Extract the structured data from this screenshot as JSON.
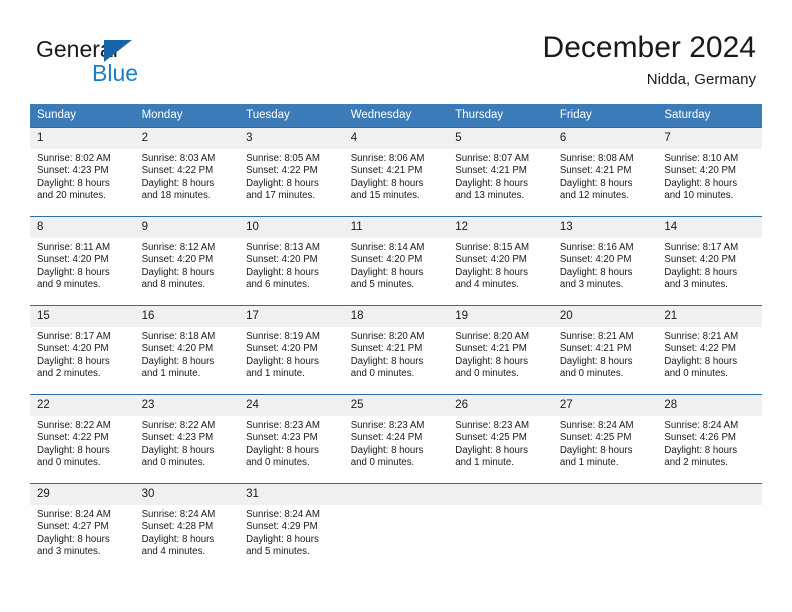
{
  "logo": {
    "word1": "General",
    "word2": "Blue",
    "triangle_color": "#1565a8",
    "blue_color": "#1b7fc4"
  },
  "header": {
    "title": "December 2024",
    "subtitle": "Nidda, Germany"
  },
  "theme": {
    "header_bar": "#3b7cb8",
    "row_divider": "#2d6ca8",
    "daynum_band": "#f0f0f0",
    "text": "#1a1a1a"
  },
  "weekday_headers": [
    "Sunday",
    "Monday",
    "Tuesday",
    "Wednesday",
    "Thursday",
    "Friday",
    "Saturday"
  ],
  "weeks": [
    [
      {
        "day": "1",
        "sunrise": "Sunrise: 8:02 AM",
        "sunset": "Sunset: 4:23 PM",
        "daylight1": "Daylight: 8 hours",
        "daylight2": "and 20 minutes."
      },
      {
        "day": "2",
        "sunrise": "Sunrise: 8:03 AM",
        "sunset": "Sunset: 4:22 PM",
        "daylight1": "Daylight: 8 hours",
        "daylight2": "and 18 minutes."
      },
      {
        "day": "3",
        "sunrise": "Sunrise: 8:05 AM",
        "sunset": "Sunset: 4:22 PM",
        "daylight1": "Daylight: 8 hours",
        "daylight2": "and 17 minutes."
      },
      {
        "day": "4",
        "sunrise": "Sunrise: 8:06 AM",
        "sunset": "Sunset: 4:21 PM",
        "daylight1": "Daylight: 8 hours",
        "daylight2": "and 15 minutes."
      },
      {
        "day": "5",
        "sunrise": "Sunrise: 8:07 AM",
        "sunset": "Sunset: 4:21 PM",
        "daylight1": "Daylight: 8 hours",
        "daylight2": "and 13 minutes."
      },
      {
        "day": "6",
        "sunrise": "Sunrise: 8:08 AM",
        "sunset": "Sunset: 4:21 PM",
        "daylight1": "Daylight: 8 hours",
        "daylight2": "and 12 minutes."
      },
      {
        "day": "7",
        "sunrise": "Sunrise: 8:10 AM",
        "sunset": "Sunset: 4:20 PM",
        "daylight1": "Daylight: 8 hours",
        "daylight2": "and 10 minutes."
      }
    ],
    [
      {
        "day": "8",
        "sunrise": "Sunrise: 8:11 AM",
        "sunset": "Sunset: 4:20 PM",
        "daylight1": "Daylight: 8 hours",
        "daylight2": "and 9 minutes."
      },
      {
        "day": "9",
        "sunrise": "Sunrise: 8:12 AM",
        "sunset": "Sunset: 4:20 PM",
        "daylight1": "Daylight: 8 hours",
        "daylight2": "and 8 minutes."
      },
      {
        "day": "10",
        "sunrise": "Sunrise: 8:13 AM",
        "sunset": "Sunset: 4:20 PM",
        "daylight1": "Daylight: 8 hours",
        "daylight2": "and 6 minutes."
      },
      {
        "day": "11",
        "sunrise": "Sunrise: 8:14 AM",
        "sunset": "Sunset: 4:20 PM",
        "daylight1": "Daylight: 8 hours",
        "daylight2": "and 5 minutes."
      },
      {
        "day": "12",
        "sunrise": "Sunrise: 8:15 AM",
        "sunset": "Sunset: 4:20 PM",
        "daylight1": "Daylight: 8 hours",
        "daylight2": "and 4 minutes."
      },
      {
        "day": "13",
        "sunrise": "Sunrise: 8:16 AM",
        "sunset": "Sunset: 4:20 PM",
        "daylight1": "Daylight: 8 hours",
        "daylight2": "and 3 minutes."
      },
      {
        "day": "14",
        "sunrise": "Sunrise: 8:17 AM",
        "sunset": "Sunset: 4:20 PM",
        "daylight1": "Daylight: 8 hours",
        "daylight2": "and 3 minutes."
      }
    ],
    [
      {
        "day": "15",
        "sunrise": "Sunrise: 8:17 AM",
        "sunset": "Sunset: 4:20 PM",
        "daylight1": "Daylight: 8 hours",
        "daylight2": "and 2 minutes."
      },
      {
        "day": "16",
        "sunrise": "Sunrise: 8:18 AM",
        "sunset": "Sunset: 4:20 PM",
        "daylight1": "Daylight: 8 hours",
        "daylight2": "and 1 minute."
      },
      {
        "day": "17",
        "sunrise": "Sunrise: 8:19 AM",
        "sunset": "Sunset: 4:20 PM",
        "daylight1": "Daylight: 8 hours",
        "daylight2": "and 1 minute."
      },
      {
        "day": "18",
        "sunrise": "Sunrise: 8:20 AM",
        "sunset": "Sunset: 4:21 PM",
        "daylight1": "Daylight: 8 hours",
        "daylight2": "and 0 minutes."
      },
      {
        "day": "19",
        "sunrise": "Sunrise: 8:20 AM",
        "sunset": "Sunset: 4:21 PM",
        "daylight1": "Daylight: 8 hours",
        "daylight2": "and 0 minutes."
      },
      {
        "day": "20",
        "sunrise": "Sunrise: 8:21 AM",
        "sunset": "Sunset: 4:21 PM",
        "daylight1": "Daylight: 8 hours",
        "daylight2": "and 0 minutes."
      },
      {
        "day": "21",
        "sunrise": "Sunrise: 8:21 AM",
        "sunset": "Sunset: 4:22 PM",
        "daylight1": "Daylight: 8 hours",
        "daylight2": "and 0 minutes."
      }
    ],
    [
      {
        "day": "22",
        "sunrise": "Sunrise: 8:22 AM",
        "sunset": "Sunset: 4:22 PM",
        "daylight1": "Daylight: 8 hours",
        "daylight2": "and 0 minutes."
      },
      {
        "day": "23",
        "sunrise": "Sunrise: 8:22 AM",
        "sunset": "Sunset: 4:23 PM",
        "daylight1": "Daylight: 8 hours",
        "daylight2": "and 0 minutes."
      },
      {
        "day": "24",
        "sunrise": "Sunrise: 8:23 AM",
        "sunset": "Sunset: 4:23 PM",
        "daylight1": "Daylight: 8 hours",
        "daylight2": "and 0 minutes."
      },
      {
        "day": "25",
        "sunrise": "Sunrise: 8:23 AM",
        "sunset": "Sunset: 4:24 PM",
        "daylight1": "Daylight: 8 hours",
        "daylight2": "and 0 minutes."
      },
      {
        "day": "26",
        "sunrise": "Sunrise: 8:23 AM",
        "sunset": "Sunset: 4:25 PM",
        "daylight1": "Daylight: 8 hours",
        "daylight2": "and 1 minute."
      },
      {
        "day": "27",
        "sunrise": "Sunrise: 8:24 AM",
        "sunset": "Sunset: 4:25 PM",
        "daylight1": "Daylight: 8 hours",
        "daylight2": "and 1 minute."
      },
      {
        "day": "28",
        "sunrise": "Sunrise: 8:24 AM",
        "sunset": "Sunset: 4:26 PM",
        "daylight1": "Daylight: 8 hours",
        "daylight2": "and 2 minutes."
      }
    ],
    [
      {
        "day": "29",
        "sunrise": "Sunrise: 8:24 AM",
        "sunset": "Sunset: 4:27 PM",
        "daylight1": "Daylight: 8 hours",
        "daylight2": "and 3 minutes."
      },
      {
        "day": "30",
        "sunrise": "Sunrise: 8:24 AM",
        "sunset": "Sunset: 4:28 PM",
        "daylight1": "Daylight: 8 hours",
        "daylight2": "and 4 minutes."
      },
      {
        "day": "31",
        "sunrise": "Sunrise: 8:24 AM",
        "sunset": "Sunset: 4:29 PM",
        "daylight1": "Daylight: 8 hours",
        "daylight2": "and 5 minutes."
      },
      {
        "day": "",
        "sunrise": "",
        "sunset": "",
        "daylight1": "",
        "daylight2": ""
      },
      {
        "day": "",
        "sunrise": "",
        "sunset": "",
        "daylight1": "",
        "daylight2": ""
      },
      {
        "day": "",
        "sunrise": "",
        "sunset": "",
        "daylight1": "",
        "daylight2": ""
      },
      {
        "day": "",
        "sunrise": "",
        "sunset": "",
        "daylight1": "",
        "daylight2": ""
      }
    ]
  ]
}
